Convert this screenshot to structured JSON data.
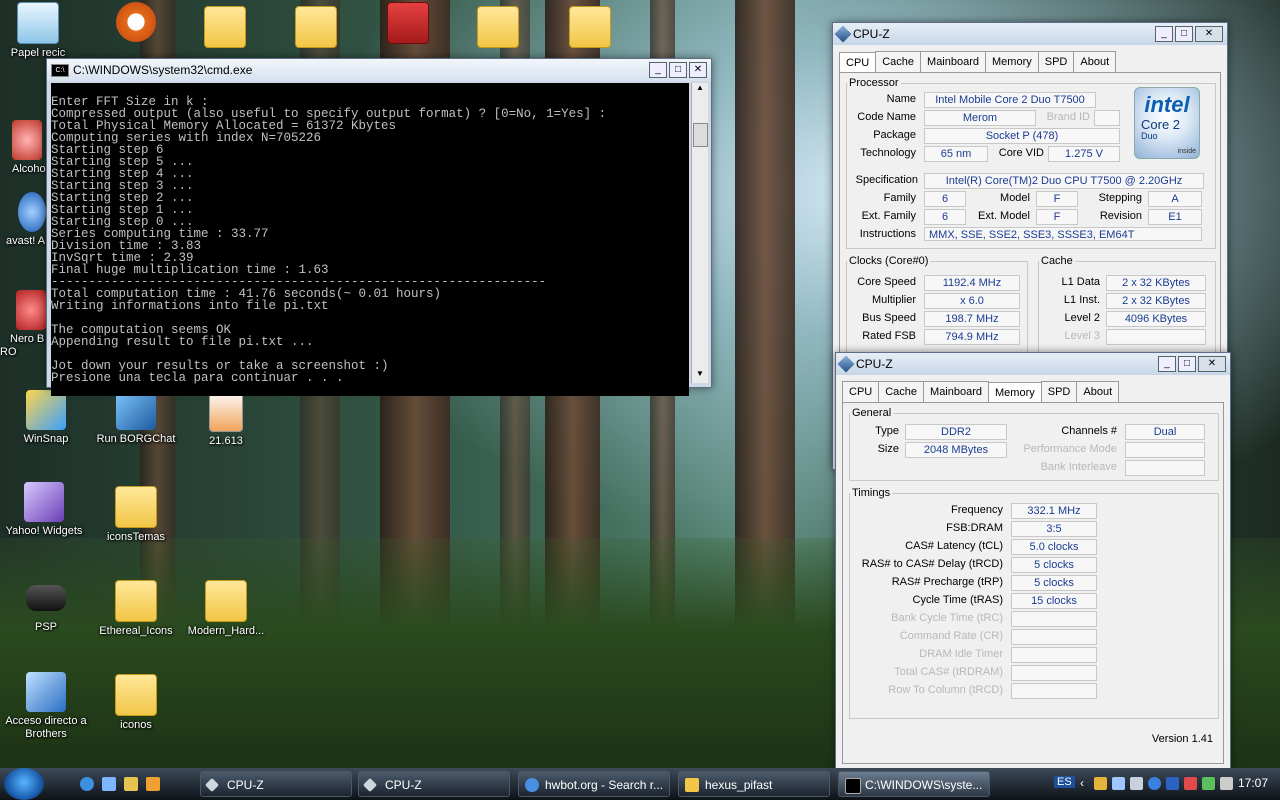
{
  "desktop": {
    "icons": [
      {
        "label": "Papel recic",
        "kind": "recycle"
      },
      {
        "label": "",
        "kind": "info"
      },
      {
        "label": "",
        "kind": "folder"
      },
      {
        "label": "",
        "kind": "folder"
      },
      {
        "label": "",
        "kind": "cabinet"
      },
      {
        "label": "",
        "kind": "folder"
      },
      {
        "label": "",
        "kind": "folder"
      },
      {
        "label": "Alcoho",
        "kind": "app"
      },
      {
        "label": "avast! A",
        "kind": "app"
      },
      {
        "label": "Nero B RO",
        "kind": "app"
      },
      {
        "label": "WinSnap",
        "kind": "app"
      },
      {
        "label": "Run BORGChat",
        "kind": "app"
      },
      {
        "label": "21.613",
        "kind": "file"
      },
      {
        "label": "Yahoo! Widgets",
        "kind": "app"
      },
      {
        "label": "iconsTemas",
        "kind": "folder"
      },
      {
        "label": "PSP",
        "kind": "app"
      },
      {
        "label": "Ethereal_Icons",
        "kind": "folder"
      },
      {
        "label": "Modern_Hard...",
        "kind": "folder"
      },
      {
        "label": "Acceso directo a Brothers",
        "kind": "app"
      },
      {
        "label": "iconos",
        "kind": "folder"
      }
    ]
  },
  "cmd": {
    "title": "C:\\WINDOWS\\system32\\cmd.exe",
    "lines": [
      "Enter FFT Size in k :",
      "Compressed output (also useful to specify output format) ? [0=No, 1=Yes] :",
      "Total Physical Memory Allocated = 61372 Kbytes",
      "Computing series with index N=705226",
      "Starting step 6",
      "Starting step 5 ...",
      "Starting step 4 ...",
      "Starting step 3 ...",
      "Starting step 2 ...",
      "Starting step 1 ...",
      "Starting step 0 ...",
      "Series computing time : 33.77",
      "Division time : 3.83",
      "InvSqrt time : 2.39",
      "Final huge multiplication time : 1.63",
      "------------------------------------------------------------------",
      "Total computation time : 41.76 seconds(~ 0.01 hours)",
      "Writing informations into file pi.txt",
      "",
      "The computation seems OK",
      "Appending result to file pi.txt ...",
      "",
      "Jot down your results or take a screenshot :)",
      "Presione una tecla para continuar . . ."
    ]
  },
  "cpuz_cpu": {
    "title": "CPU-Z",
    "tabs": [
      "CPU",
      "Cache",
      "Mainboard",
      "Memory",
      "SPD",
      "About"
    ],
    "active_tab": "CPU",
    "processor": {
      "legend": "Processor",
      "name_label": "Name",
      "name": "Intel Mobile Core 2 Duo T7500",
      "codename_label": "Code Name",
      "codename": "Merom",
      "brandid_label": "Brand ID",
      "brandid": "",
      "package_label": "Package",
      "package": "Socket P (478)",
      "technology_label": "Technology",
      "technology": "65 nm",
      "corevid_label": "Core VID",
      "corevid": "1.275 V",
      "spec_label": "Specification",
      "spec": "Intel(R) Core(TM)2 Duo CPU     T7500  @ 2.20GHz",
      "family_label": "Family",
      "family": "6",
      "model_label": "Model",
      "model": "F",
      "stepping_label": "Stepping",
      "stepping": "A",
      "extfamily_label": "Ext. Family",
      "extfamily": "6",
      "extmodel_label": "Ext. Model",
      "extmodel": "F",
      "revision_label": "Revision",
      "revision": "E1",
      "instructions_label": "Instructions",
      "instructions": "MMX, SSE, SSE2, SSE3, SSSE3, EM64T"
    },
    "logo": {
      "brand": "intel",
      "line1": "Core 2",
      "line2": "Duo",
      "tag": "inside"
    },
    "clocks": {
      "legend": "Clocks (Core#0)",
      "corespeed_label": "Core Speed",
      "corespeed": "1192.4 MHz",
      "multiplier_label": "Multiplier",
      "multiplier": "x 6.0",
      "busspeed_label": "Bus Speed",
      "busspeed": "198.7 MHz",
      "ratedfsb_label": "Rated FSB",
      "ratedfsb": "794.9 MHz"
    },
    "cache": {
      "legend": "Cache",
      "l1data_label": "L1 Data",
      "l1data": "2 x 32 KBytes",
      "l1inst_label": "L1 Inst.",
      "l1inst": "2 x 32 KBytes",
      "level2_label": "Level 2",
      "level2": "4096 KBytes",
      "level3_label": "Level 3",
      "level3": ""
    }
  },
  "cpuz_mem": {
    "title": "CPU-Z",
    "tabs": [
      "CPU",
      "Cache",
      "Mainboard",
      "Memory",
      "SPD",
      "About"
    ],
    "active_tab": "Memory",
    "general": {
      "legend": "General",
      "type_label": "Type",
      "type": "DDR2",
      "channels_label": "Channels #",
      "channels": "Dual",
      "size_label": "Size",
      "size": "2048 MBytes",
      "perfmode_label": "Performance Mode",
      "perfmode": "",
      "bankinter_label": "Bank Interleave",
      "bankinter": ""
    },
    "timings": {
      "legend": "Timings",
      "rows": [
        {
          "label": "Frequency",
          "value": "332.1 MHz",
          "dim": false
        },
        {
          "label": "FSB:DRAM",
          "value": "3:5",
          "dim": false
        },
        {
          "label": "CAS# Latency (tCL)",
          "value": "5.0 clocks",
          "dim": false
        },
        {
          "label": "RAS# to CAS# Delay (tRCD)",
          "value": "5 clocks",
          "dim": false
        },
        {
          "label": "RAS# Precharge (tRP)",
          "value": "5 clocks",
          "dim": false
        },
        {
          "label": "Cycle Time (tRAS)",
          "value": "15 clocks",
          "dim": false
        },
        {
          "label": "Bank Cycle Time (tRC)",
          "value": "",
          "dim": true
        },
        {
          "label": "Command Rate (CR)",
          "value": "",
          "dim": true
        },
        {
          "label": "DRAM Idle Timer",
          "value": "",
          "dim": true
        },
        {
          "label": "Total CAS# (tRDRAM)",
          "value": "",
          "dim": true
        },
        {
          "label": "Row To Column (tRCD)",
          "value": "",
          "dim": true
        }
      ]
    },
    "version": "Version 1.41"
  },
  "taskbar": {
    "buttons": [
      {
        "label": "CPU-Z"
      },
      {
        "label": "CPU-Z"
      },
      {
        "label": "hwbot.org - Search r..."
      },
      {
        "label": "hexus_pifast"
      },
      {
        "label": "C:\\WINDOWS\\syste..."
      }
    ],
    "language": "ES",
    "clock": "17:07"
  }
}
